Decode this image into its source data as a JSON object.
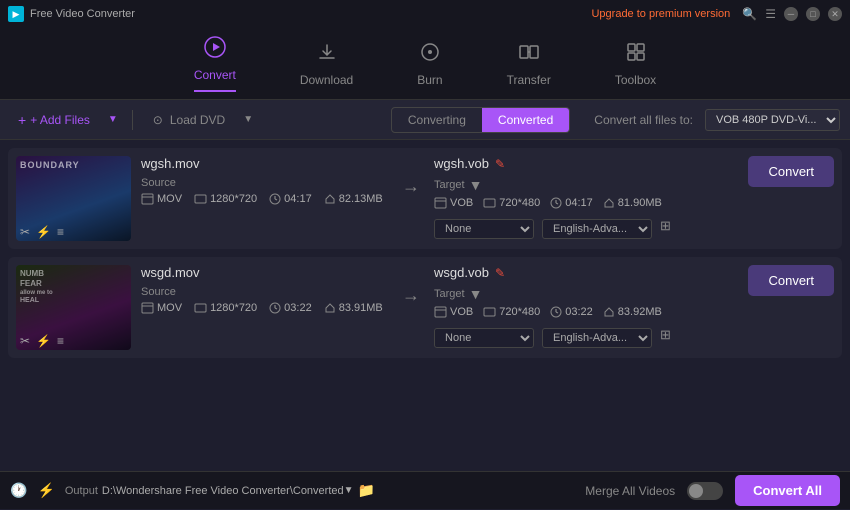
{
  "app": {
    "title": "Free Video Converter",
    "upgrade_label": "Upgrade to premium version"
  },
  "nav": {
    "items": [
      {
        "id": "convert",
        "label": "Convert",
        "icon": "▶",
        "active": true
      },
      {
        "id": "download",
        "label": "Download",
        "icon": "⬇",
        "active": false
      },
      {
        "id": "burn",
        "label": "Burn",
        "icon": "⏺",
        "active": false
      },
      {
        "id": "transfer",
        "label": "Transfer",
        "icon": "⇄",
        "active": false
      },
      {
        "id": "toolbox",
        "label": "Toolbox",
        "icon": "⊞",
        "active": false
      }
    ]
  },
  "toolbar": {
    "add_files_label": "+ Add Files",
    "load_dvd_label": "⊙ Load DVD",
    "tab_converting": "Converting",
    "tab_converted": "Converted",
    "convert_all_label": "Convert all files to:",
    "convert_all_value": "VOB 480P DVD-Vi..."
  },
  "files": [
    {
      "id": "file1",
      "source_name": "wgsh.mov",
      "target_name": "wgsh.vob",
      "thumb_label": "BOUNDARY",
      "source": {
        "format": "MOV",
        "resolution": "1280*720",
        "duration": "04:17",
        "size": "82.13MB"
      },
      "target": {
        "format": "VOB",
        "resolution": "720*480",
        "duration": "04:17",
        "size": "81.90MB"
      },
      "quality": "None",
      "language": "English-Adva...",
      "convert_label": "Convert"
    },
    {
      "id": "file2",
      "source_name": "wsgd.mov",
      "target_name": "wsgd.vob",
      "thumb_label": "FEAR",
      "source": {
        "format": "MOV",
        "resolution": "1280*720",
        "duration": "03:22",
        "size": "83.91MB"
      },
      "target": {
        "format": "VOB",
        "resolution": "720*480",
        "duration": "03:22",
        "size": "83.92MB"
      },
      "quality": "None",
      "language": "English-Adva...",
      "convert_label": "Convert"
    }
  ],
  "bottom": {
    "output_label": "Output",
    "output_path": "D:\\Wondershare Free Video Converter\\Converted",
    "merge_label": "Merge All Videos",
    "convert_all_label": "Convert All"
  }
}
